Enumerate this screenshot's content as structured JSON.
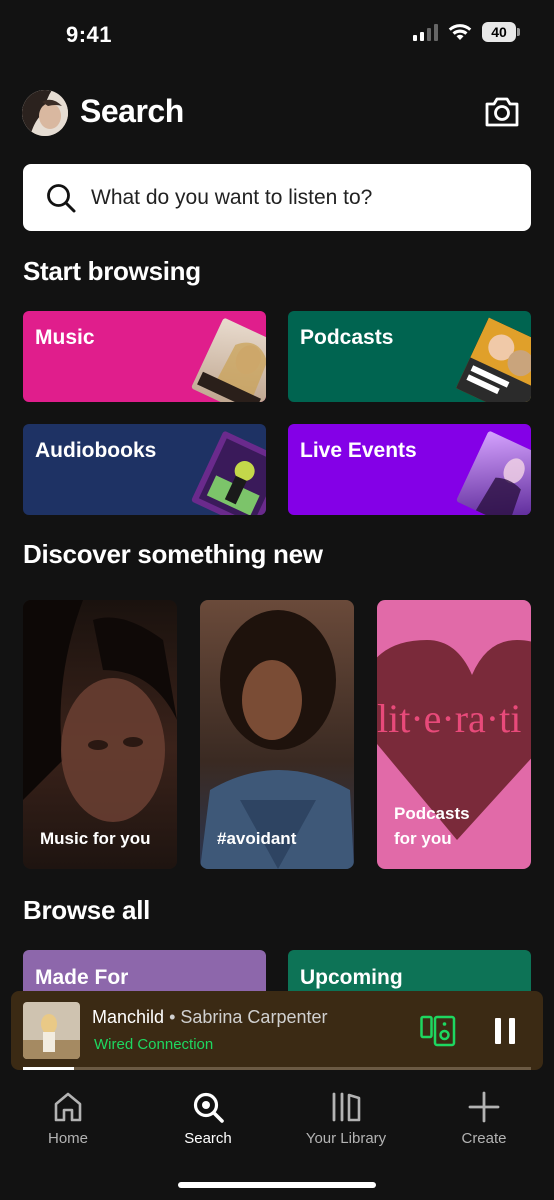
{
  "status_bar": {
    "time": "9:41",
    "battery": "40"
  },
  "header": {
    "title": "Search"
  },
  "search": {
    "placeholder": "What do you want to listen to?"
  },
  "start_browsing": {
    "title": "Start browsing",
    "tiles": [
      {
        "label": "Music",
        "color": "#e01e8c"
      },
      {
        "label": "Podcasts",
        "color": "#006450"
      },
      {
        "label": "Audiobooks",
        "color": "#1e3264"
      },
      {
        "label": "Live Events",
        "color": "#8400e7"
      }
    ]
  },
  "discover": {
    "title": "Discover something new",
    "cards": [
      {
        "label": "Music for you"
      },
      {
        "label": "#avoidant"
      },
      {
        "label_line1": "Podcasts",
        "label_line2": "for you",
        "art_text": "lit·e·ra·ti"
      }
    ]
  },
  "browse_all": {
    "title": "Browse all",
    "tiles": [
      {
        "label": "Made For",
        "color": "#8d67ab"
      },
      {
        "label": "Upcoming",
        "color": "#0d7356"
      }
    ]
  },
  "player": {
    "track": "Manchild",
    "separator": "•",
    "artist": "Sabrina Carpenter",
    "device": "Wired Connection",
    "progress": 0.1
  },
  "nav": {
    "home": "Home",
    "search": "Search",
    "library": "Your Library",
    "create": "Create"
  },
  "colors": {
    "accent": "#1ed760",
    "background": "#121212"
  }
}
